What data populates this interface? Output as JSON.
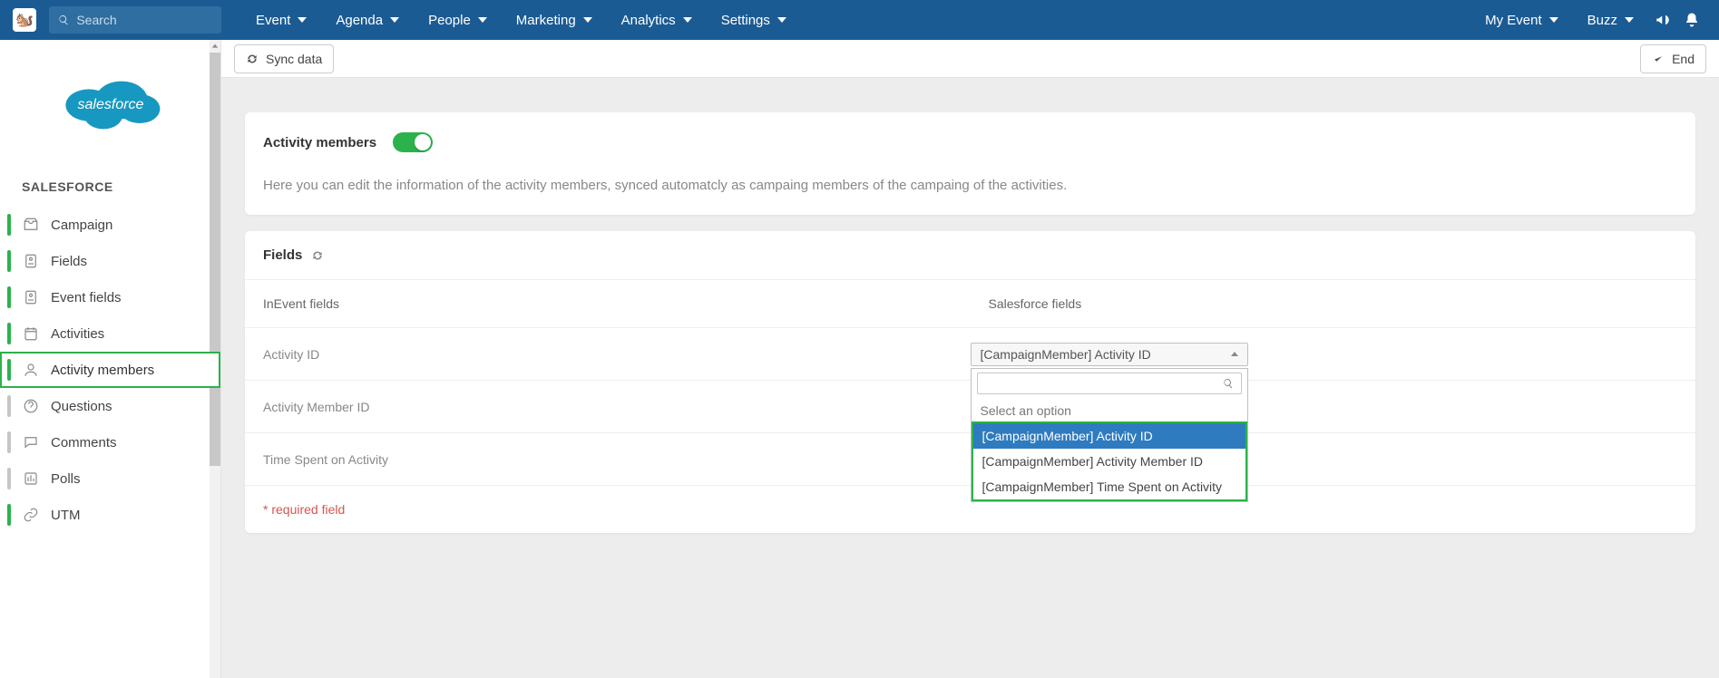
{
  "topnav": {
    "search_placeholder": "Search",
    "items": [
      "Event",
      "Agenda",
      "People",
      "Marketing",
      "Analytics",
      "Settings"
    ],
    "right_items": [
      "My Event",
      "Buzz"
    ]
  },
  "toolbar": {
    "sync_label": "Sync data",
    "end_label": "End"
  },
  "sidebar": {
    "title": "SALESFORCE",
    "items": [
      {
        "label": "Campaign"
      },
      {
        "label": "Fields"
      },
      {
        "label": "Event fields"
      },
      {
        "label": "Activities"
      },
      {
        "label": "Activity members"
      },
      {
        "label": "Questions"
      },
      {
        "label": "Comments"
      },
      {
        "label": "Polls"
      },
      {
        "label": "UTM"
      }
    ]
  },
  "card1": {
    "title": "Activity members",
    "desc": "Here you can edit the information of the activity members, synced automatcly as campaing members of the campaing of the activities."
  },
  "card2": {
    "title": "Fields",
    "col_left": "InEvent fields",
    "col_right": "Salesforce fields",
    "rows": [
      {
        "label": "Activity ID",
        "selected": "[CampaignMember] Activity ID"
      },
      {
        "label": "Activity Member ID"
      },
      {
        "label": "Time Spent on Activity"
      }
    ],
    "dropdown": {
      "placeholder_option": "Select an option",
      "options": [
        "[CampaignMember] Activity ID",
        "[CampaignMember] Activity Member ID",
        "[CampaignMember] Time Spent on Activity"
      ]
    },
    "required_note": "* required field"
  }
}
